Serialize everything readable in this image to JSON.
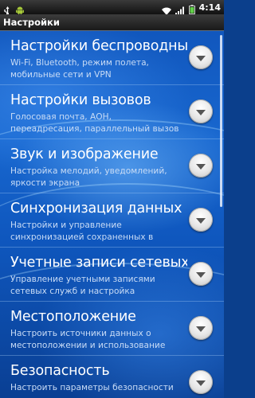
{
  "status_bar": {
    "time": "4:14",
    "icons": [
      "usb-icon",
      "android-icon",
      "wifi-icon",
      "signal-icon",
      "battery-icon"
    ]
  },
  "header": {
    "title": "Настройки"
  },
  "settings": [
    {
      "title": "Настройки беспроводных сетей",
      "desc_lines": [
        "Wi-Fi, Bluetooth, режим полета,",
        "мобильные сети и VPN"
      ]
    },
    {
      "title": "Настройки вызовов",
      "desc_lines": [
        "Голосовая почта, АОН,",
        "переадресация, параллельный вызов"
      ]
    },
    {
      "title": "Звук и изображение",
      "desc_lines": [
        "Настройка мелодий, уведомлений,",
        "яркости экрана"
      ]
    },
    {
      "title": "Синхронизация данных",
      "desc_lines": [
        "Настройки и управление",
        "синхронизацией сохраненных в"
      ]
    },
    {
      "title": "Учетные записи сетевых служб",
      "desc_lines": [
        "Управление учетными записями",
        "сетевых служб и настройка"
      ]
    },
    {
      "title": "Местоположение",
      "desc_lines": [
        "Настроить источники данных о",
        "местоположении и использование"
      ]
    },
    {
      "title": "Безопасность",
      "desc_lines": [
        "Настроить параметры безопасности",
        ""
      ]
    }
  ]
}
